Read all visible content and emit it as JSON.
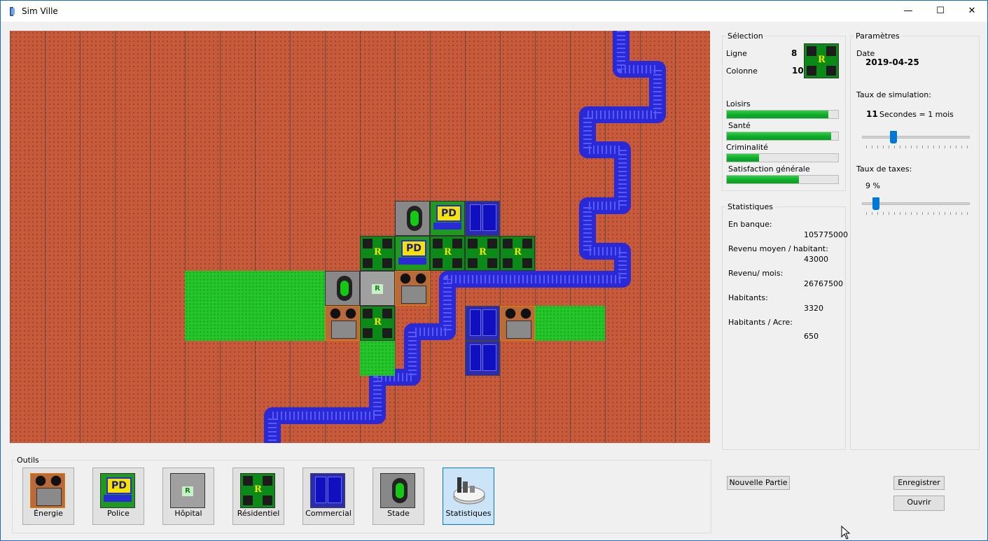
{
  "window": {
    "title": "Sim Ville",
    "minimize": "—",
    "maximize": "☐",
    "close": "✕"
  },
  "selection": {
    "legend": "Sélection",
    "ligne_label": "Ligne",
    "ligne_value": "8",
    "colonne_label": "Colonne",
    "colonne_value": "10",
    "preview_icon": "residential-tile",
    "loisirs_label": "Loisirs",
    "loisirs": 0.91,
    "sante_label": "Santé",
    "sante": 0.94,
    "criminalite_label": "Criminalité",
    "criminalite": 0.29,
    "satisfaction_label": "Satisfaction générale",
    "satisfaction": 0.65
  },
  "statistiques": {
    "legend": "Statistiques",
    "banque_label": "En banque:",
    "banque_value": "105775000",
    "revenu_moyen_label": "Revenu moyen / habitant:",
    "revenu_moyen_value": "43000",
    "revenu_mois_label": "Revenu/ mois:",
    "revenu_mois_value": "26767500",
    "habitants_label": "Habitants:",
    "habitants_value": "3320",
    "habitants_acre_label": "Habitants / Acre:",
    "habitants_acre_value": "650"
  },
  "parametres": {
    "legend": "Paramètres",
    "date_label": "Date",
    "date_value": "2019-04-25",
    "taux_sim_label": "Taux de simulation:",
    "taux_sim_value": "11",
    "taux_sim_unit": "Secondes = 1 mois",
    "taux_sim_level": 0.27,
    "taux_taxes_label": "Taux de taxes:",
    "taux_taxes_value": "9 %",
    "taux_taxes_level": 0.09
  },
  "tools": {
    "legend": "Outils",
    "items": [
      {
        "label": "Énergie",
        "icon": "power-plant-icon"
      },
      {
        "label": "Police",
        "icon": "police-icon"
      },
      {
        "label": "Hôpital",
        "icon": "hospital-icon"
      },
      {
        "label": "Résidentiel",
        "icon": "residential-icon"
      },
      {
        "label": "Commercial",
        "icon": "commercial-icon"
      },
      {
        "label": "Stade",
        "icon": "stadium-icon"
      },
      {
        "label": "Statistiques",
        "icon": "statistics-icon"
      }
    ]
  },
  "buttons": {
    "nouvelle_partie": "Nouvelle Partie",
    "enregistrer": "Enregistrer",
    "ouvrir": "Ouvrir"
  },
  "map": {
    "rows": 12,
    "cols": 20,
    "terrain_color": "#c65a3b",
    "grass_color": "#25c62b",
    "water_color": "#3a3ae0",
    "tile_letters": {
      "residential": "R",
      "police": "PD",
      "hospital": "R"
    }
  }
}
